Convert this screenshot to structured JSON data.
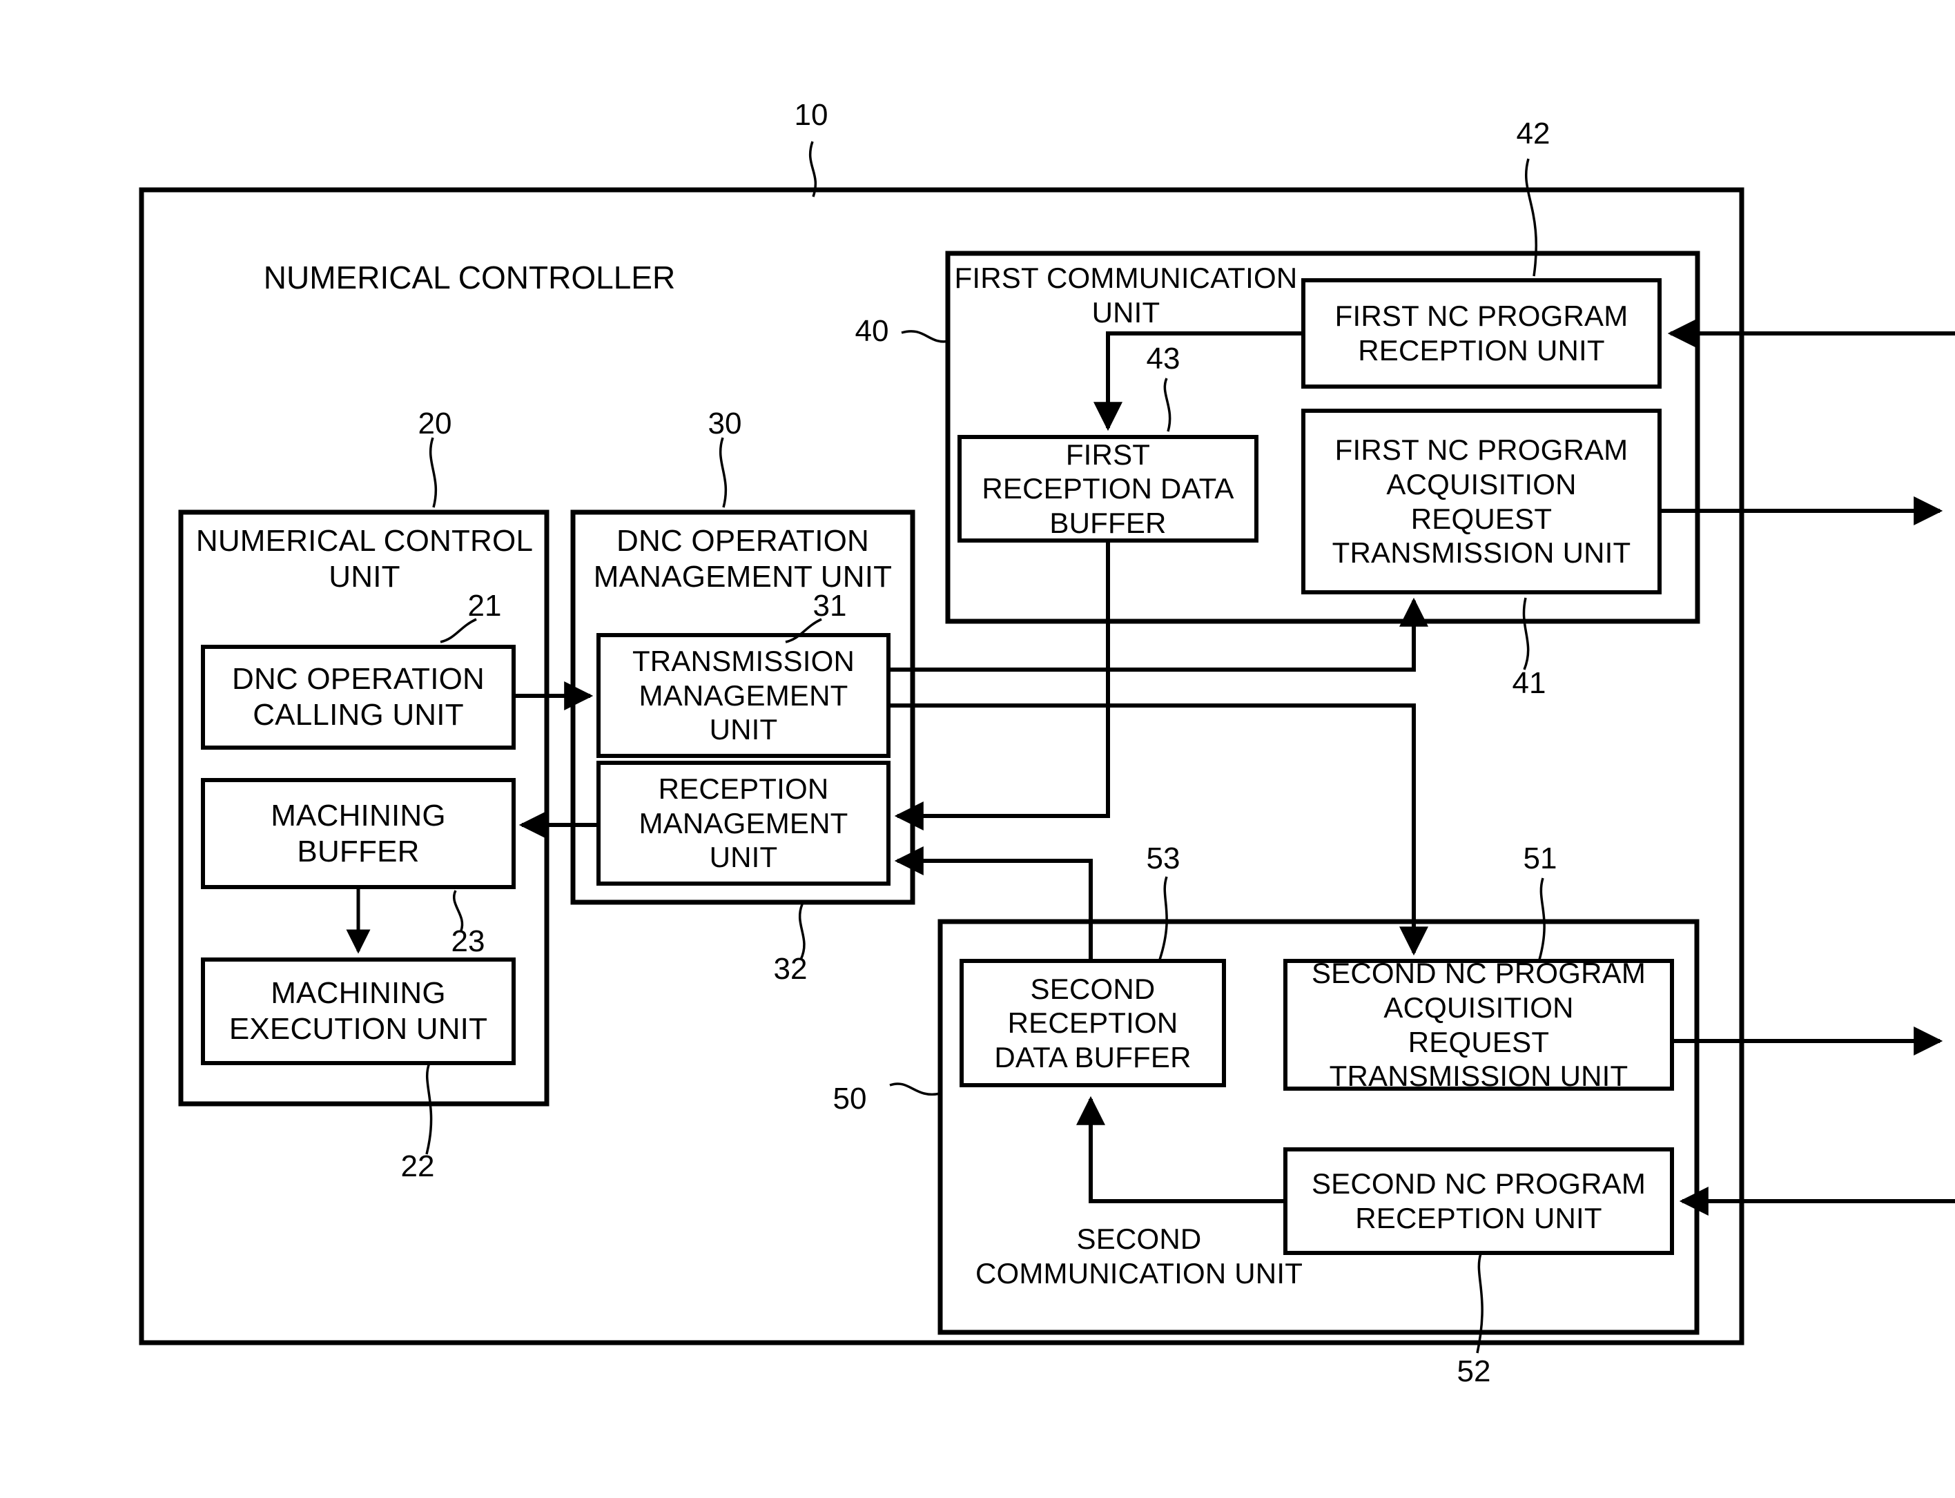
{
  "figure": {
    "type": "patent-block-diagram",
    "outer_frame_label": "10"
  },
  "outer": {
    "title": "NUMERICAL CONTROLLER",
    "ref": "10"
  },
  "numerical_control_unit": {
    "title_line1": "NUMERICAL CONTROL",
    "title_line2": "UNIT",
    "ref": "20",
    "children": [
      {
        "ref": "21",
        "line1": "DNC OPERATION",
        "line2": "CALLING UNIT"
      },
      {
        "ref": "23",
        "line1": "MACHINING",
        "line2": "BUFFER"
      },
      {
        "ref": "22",
        "line1": "MACHINING",
        "line2": "EXECUTION UNIT"
      }
    ]
  },
  "dnc_operation_management_unit": {
    "title_line1": "DNC OPERATION",
    "title_line2": "MANAGEMENT UNIT",
    "ref": "30",
    "children": [
      {
        "ref": "31",
        "line1": "TRANSMISSION",
        "line2": "MANAGEMENT",
        "line3": "UNIT"
      },
      {
        "ref": "32",
        "line1": "RECEPTION",
        "line2": "MANAGEMENT",
        "line3": "UNIT"
      }
    ]
  },
  "first_communication_unit": {
    "title_line1": "FIRST COMMUNICATION",
    "title_line2": "UNIT",
    "ref": "40",
    "children": [
      {
        "ref": "42",
        "line1": "FIRST NC PROGRAM",
        "line2": "RECEPTION UNIT"
      },
      {
        "ref": "41",
        "line1": "FIRST NC PROGRAM",
        "line2": "ACQUISITION",
        "line3": "REQUEST",
        "line4": "TRANSMISSION UNIT"
      },
      {
        "ref": "43",
        "line1": "FIRST",
        "line2": "RECEPTION DATA",
        "line3": "BUFFER"
      }
    ]
  },
  "second_communication_unit": {
    "title_line1": "SECOND",
    "title_line2": "COMMUNICATION UNIT",
    "ref": "50",
    "children": [
      {
        "ref": "53",
        "line1": "SECOND",
        "line2": "RECEPTION",
        "line3": "DATA BUFFER"
      },
      {
        "ref": "51",
        "line1": "SECOND NC PROGRAM",
        "line2": "ACQUISITION",
        "line3": "REQUEST",
        "line4": "TRANSMISSION UNIT"
      },
      {
        "ref": "52",
        "line1": "SECOND NC PROGRAM",
        "line2": "RECEPTION UNIT"
      }
    ]
  },
  "colors": {
    "stroke": "#000000",
    "background": "#ffffff",
    "text": "#000000"
  }
}
